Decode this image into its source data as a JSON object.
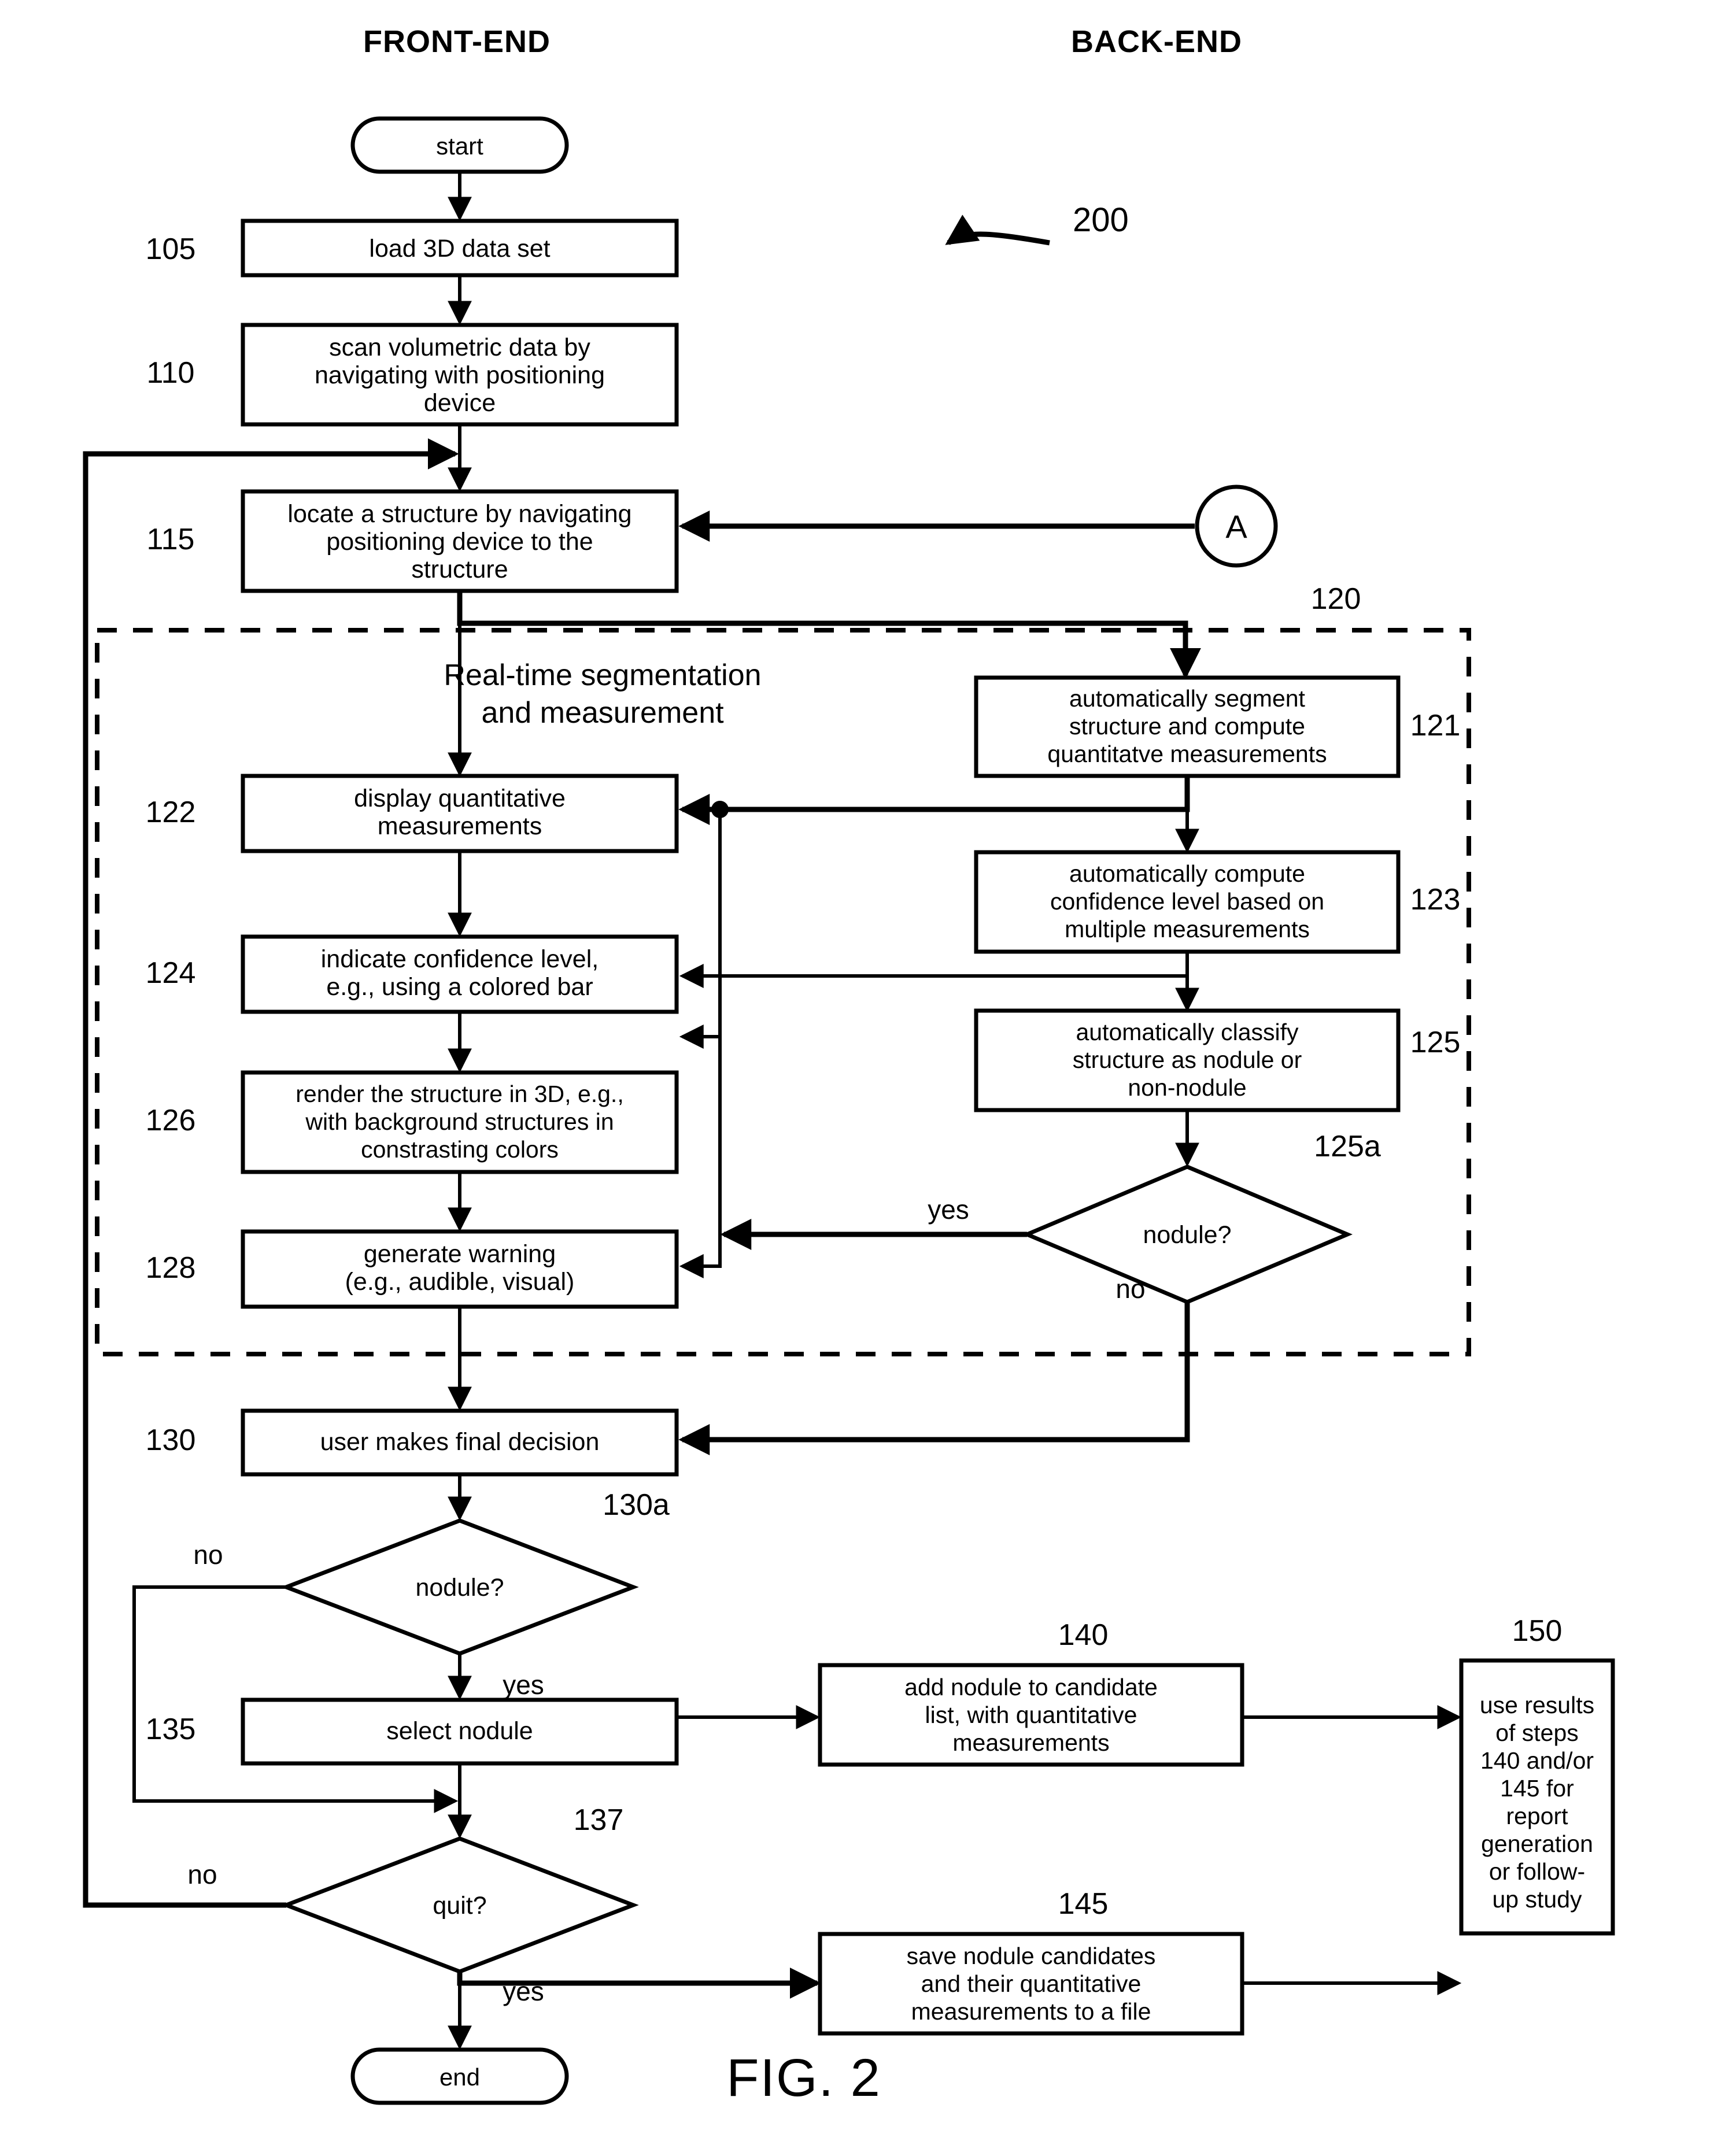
{
  "figure": {
    "label": "FIG. 2",
    "reference_numeral": "200"
  },
  "columns": {
    "front_end": "FRONT-END",
    "back_end": "BACK-END"
  },
  "terminators": {
    "start": "start",
    "end": "end"
  },
  "connector": {
    "a": "A"
  },
  "group": {
    "ref": "120",
    "title_line1": "Real-time segmentation",
    "title_line2": "and measurement"
  },
  "steps": {
    "s105": {
      "ref": "105",
      "lines": [
        "load 3D data set"
      ]
    },
    "s110": {
      "ref": "110",
      "lines": [
        "scan volumetric data by",
        "navigating with positioning",
        "device"
      ]
    },
    "s115": {
      "ref": "115",
      "lines": [
        "locate a structure by navigating",
        "positioning device to the",
        "structure"
      ]
    },
    "s121": {
      "ref": "121",
      "lines": [
        "automatically segment",
        "structure and compute",
        "quantitatve measurements"
      ]
    },
    "s122": {
      "ref": "122",
      "lines": [
        "display quantitative",
        "measurements"
      ]
    },
    "s123": {
      "ref": "123",
      "lines": [
        "automatically compute",
        "confidence level based on",
        "multiple measurements"
      ]
    },
    "s124": {
      "ref": "124",
      "lines": [
        "indicate confidence level,",
        "e.g., using a colored bar"
      ]
    },
    "s125": {
      "ref": "125",
      "lines": [
        "automatically classify",
        "structure as nodule or",
        "non-nodule"
      ]
    },
    "s125a": {
      "ref": "125a",
      "lines": [
        "nodule?"
      ],
      "yes": "yes",
      "no": "no"
    },
    "s126": {
      "ref": "126",
      "lines": [
        "render the structure in 3D, e.g.,",
        "with background structures in",
        "constrasting colors"
      ]
    },
    "s128": {
      "ref": "128",
      "lines": [
        "generate warning",
        "(e.g., audible, visual)"
      ]
    },
    "s130": {
      "ref": "130",
      "lines": [
        "user makes final decision"
      ]
    },
    "s130a": {
      "ref": "130a",
      "lines": [
        "nodule?"
      ],
      "yes": "yes",
      "no": "no"
    },
    "s135": {
      "ref": "135",
      "lines": [
        "select nodule"
      ]
    },
    "s137": {
      "ref": "137",
      "lines": [
        "quit?"
      ],
      "yes": "yes",
      "no": "no"
    },
    "s140": {
      "ref": "140",
      "lines": [
        "add nodule to candidate",
        "list, with quantitative",
        "measurements"
      ]
    },
    "s145": {
      "ref": "145",
      "lines": [
        "save nodule candidates",
        "and their quantitative",
        "measurements to a file"
      ]
    },
    "s150": {
      "ref": "150",
      "lines": [
        "use results",
        "of steps",
        "140 and/or",
        "145 for",
        "report",
        "generation",
        "or follow-",
        "up study"
      ]
    }
  },
  "colors": {
    "ink": "#000000",
    "paper": "#ffffff"
  }
}
